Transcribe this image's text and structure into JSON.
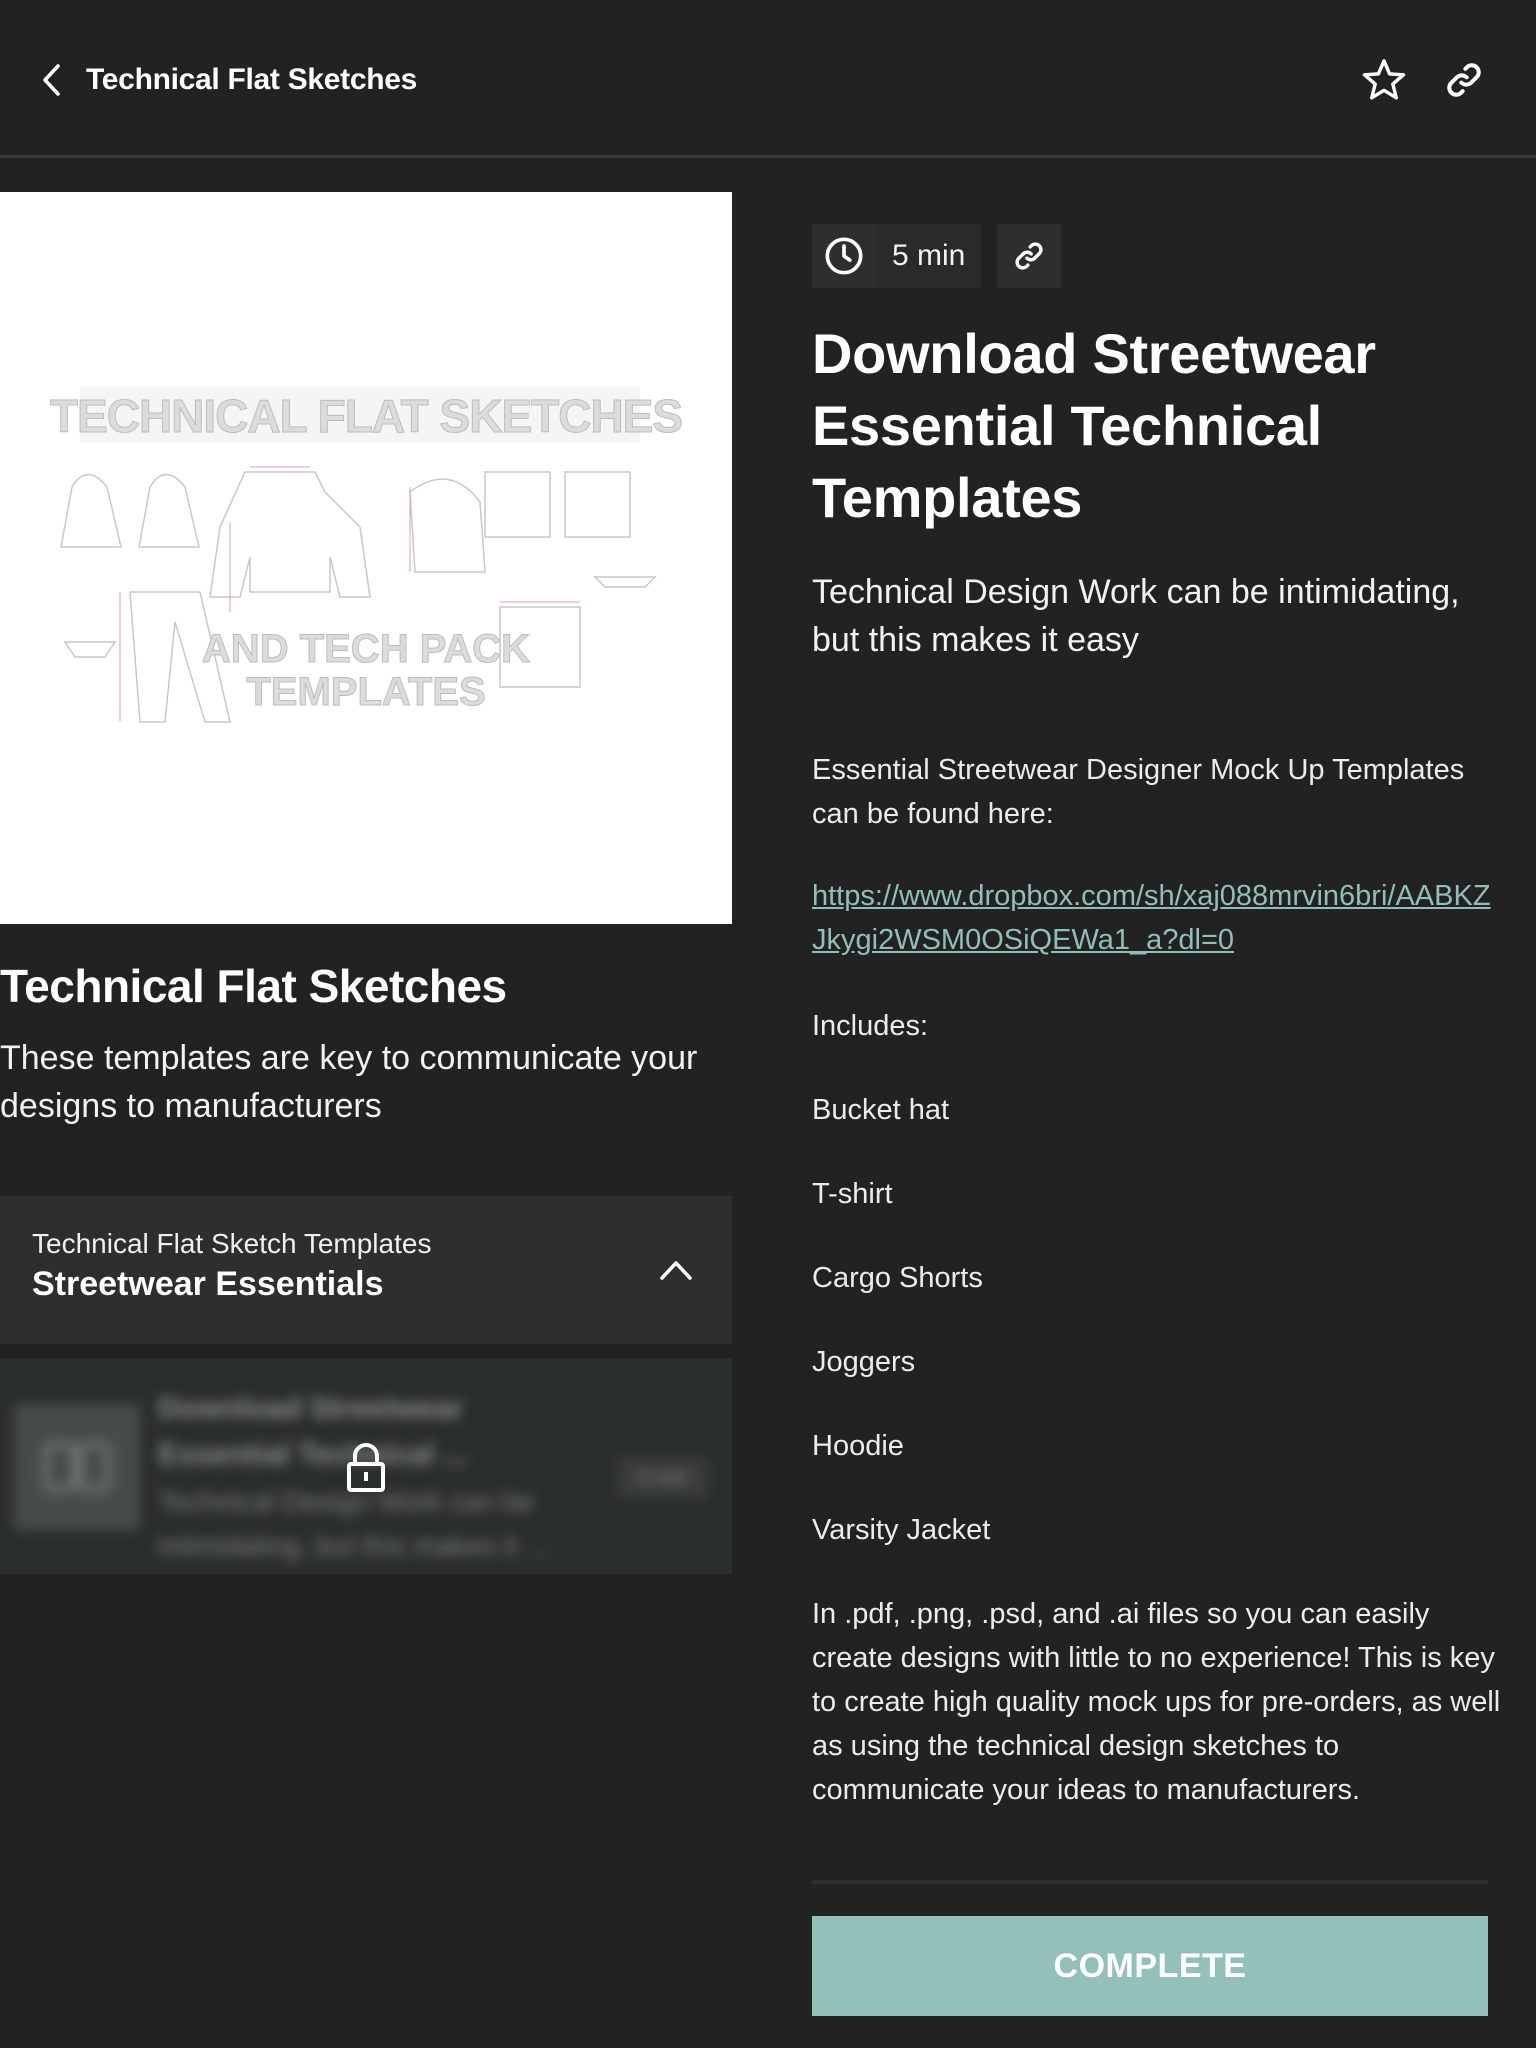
{
  "header": {
    "title": "Technical Flat Sketches",
    "back_icon": "chevron-left-icon",
    "actions": [
      {
        "name": "favorite",
        "icon": "star-outline-icon"
      },
      {
        "name": "share-link",
        "icon": "link-icon"
      }
    ]
  },
  "course": {
    "hero_image": {
      "headline": "TECHNICAL FLAT SKETCHES",
      "subline_1": "AND TECH PACK",
      "subline_2": "TEMPLATES"
    },
    "title": "Technical Flat Sketches",
    "description": "These templates are key to communicate your designs to manufacturers"
  },
  "section": {
    "subtitle": "Technical Flat Sketch Templates",
    "title": "Streetwear Essentials",
    "expanded": true,
    "items": [
      {
        "title": "Download Streetwear Essential Technical ...",
        "description": "Technical Design Work can be intimidating, but this makes it ...",
        "duration": "5 min",
        "locked": true,
        "icon": "book-open-icon"
      }
    ]
  },
  "lesson": {
    "duration": "5 min",
    "title": "Download Streetwear Essential Technical Templates",
    "intro": "Technical Design Work can be intimidating, but this makes it easy",
    "found_here": "Essential Streetwear Designer Mock Up Templates can be found here:",
    "link_text": "https://www.dropbox.com/sh/xaj088mrvin6bri/AABKZJkygi2WSM0OSiQEWa1_a?dl=0",
    "includes_label": "Includes:",
    "includes": [
      "Bucket hat",
      "T-shirt",
      "Cargo Shorts",
      "Joggers",
      "Hoodie",
      "Varsity Jacket"
    ],
    "formats_paragraph": "In .pdf, .png, .psd, and .ai files so you can easily create designs with little to no experience! This is key to create high quality mock ups for pre-orders, as well as using the technical design sketches to communicate your ideas to manufacturers.",
    "complete_label": "COMPLETE"
  },
  "colors": {
    "background": "#222222",
    "accent": "#93c0b8",
    "link": "#8fbfb8",
    "panel": "#2e2e2e"
  }
}
